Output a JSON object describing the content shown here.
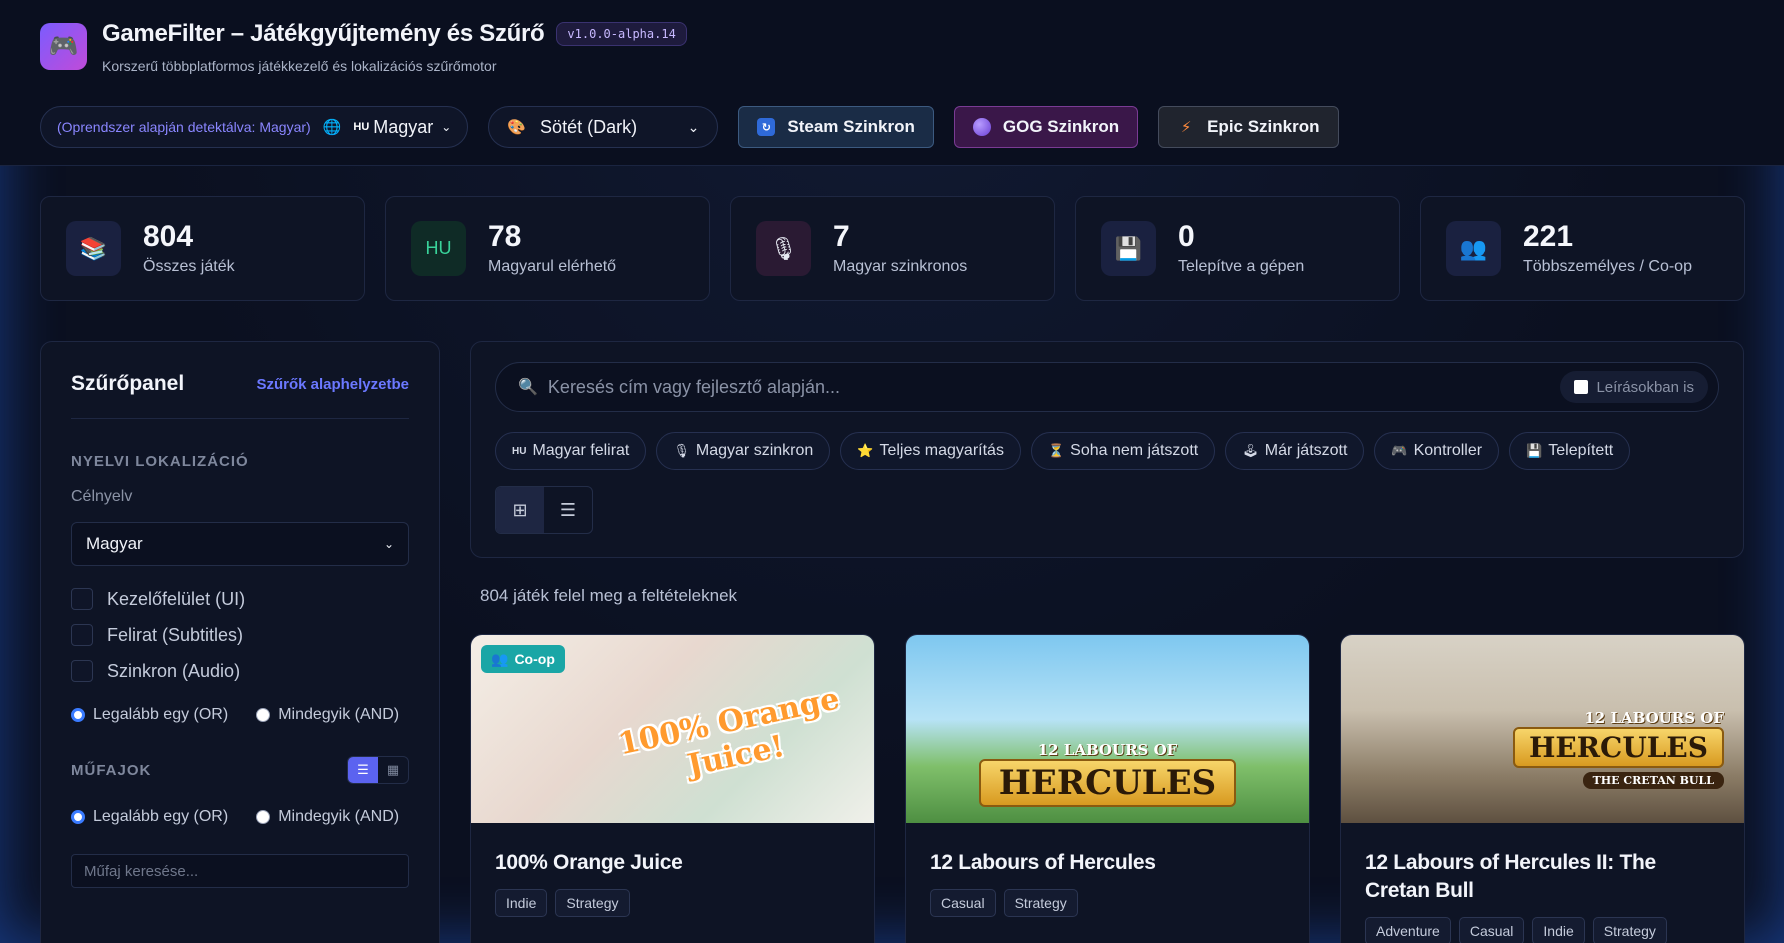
{
  "header": {
    "title": "GameFilter – Játékgyűjtemény és Szűrő",
    "version": "v1.0.0-alpha.14",
    "subtitle": "Korszerű többplatformos játékkezelő és lokalizációs szűrőmotor",
    "detected": "(Oprendszer alapján detektálva: Magyar)",
    "lang_flag": "HU",
    "lang_value": "Magyar",
    "theme_value": "Sötét (Dark)",
    "sync": {
      "steam": "Steam Szinkron",
      "gog": "GOG Szinkron",
      "epic": "Epic Szinkron"
    }
  },
  "stats": [
    {
      "value": "804",
      "label": "Összes játék",
      "icon": "books-icon"
    },
    {
      "value": "78",
      "label": "Magyarul elérhető",
      "icon": "hu-flag-icon",
      "icon_text": "HU"
    },
    {
      "value": "7",
      "label": "Magyar szinkronos",
      "icon": "microphone-icon"
    },
    {
      "value": "0",
      "label": "Telepítve a gépen",
      "icon": "floppy-icon"
    },
    {
      "value": "221",
      "label": "Többszemélyes / Co-op",
      "icon": "users-icon"
    }
  ],
  "sidebar": {
    "title": "Szűrőpanel",
    "reset": "Szűrők alaphelyzetbe",
    "lang_section": "NYELVI LOKALIZÁCIÓ",
    "target_label": "Célnyelv",
    "target_value": "Magyar",
    "checks": [
      "Kezelőfelület (UI)",
      "Felirat (Subtitles)",
      "Szinkron (Audio)"
    ],
    "radio_or": "Legalább egy (OR)",
    "radio_and": "Mindegyik (AND)",
    "genre_section": "MŰFAJOK",
    "genre_search_placeholder": "Műfaj keresése..."
  },
  "main": {
    "search_placeholder": "Keresés cím vagy fejlesztő alapján...",
    "desc_toggle": "Leírásokban is",
    "chips": [
      {
        "icon": "HU",
        "label": "Magyar felirat"
      },
      {
        "icon": "🎙",
        "label": "Magyar szinkron"
      },
      {
        "icon": "⭐",
        "label": "Teljes magyarítás"
      },
      {
        "icon": "⏳",
        "label": "Soha nem játszott"
      },
      {
        "icon": "🕹",
        "label": "Már játszott"
      },
      {
        "icon": "🎮",
        "label": "Kontroller"
      },
      {
        "icon": "💾",
        "label": "Telepített"
      }
    ],
    "result_count": "804 játék felel meg a feltételeknek"
  },
  "cards": [
    {
      "title": "100% Orange Juice",
      "badge": "Co-op",
      "art": "100% Orange Juice!",
      "tags": [
        "Indie",
        "Strategy"
      ]
    },
    {
      "title": "12 Labours of Hercules",
      "art_top": "12 LABOURS OF",
      "art_main": "HERCULES",
      "tags": [
        "Casual",
        "Strategy"
      ]
    },
    {
      "title": "12 Labours of Hercules II: The Cretan Bull",
      "art_top": "12 LABOURS OF",
      "art_main": "HERCULES",
      "art_sub": "THE CRETAN BULL",
      "tags": [
        "Adventure",
        "Casual",
        "Indie",
        "Strategy"
      ]
    }
  ],
  "colors": {
    "accent": "#5b63f0",
    "link": "#6b78ff",
    "coop_badge": "#1aa6a6"
  }
}
